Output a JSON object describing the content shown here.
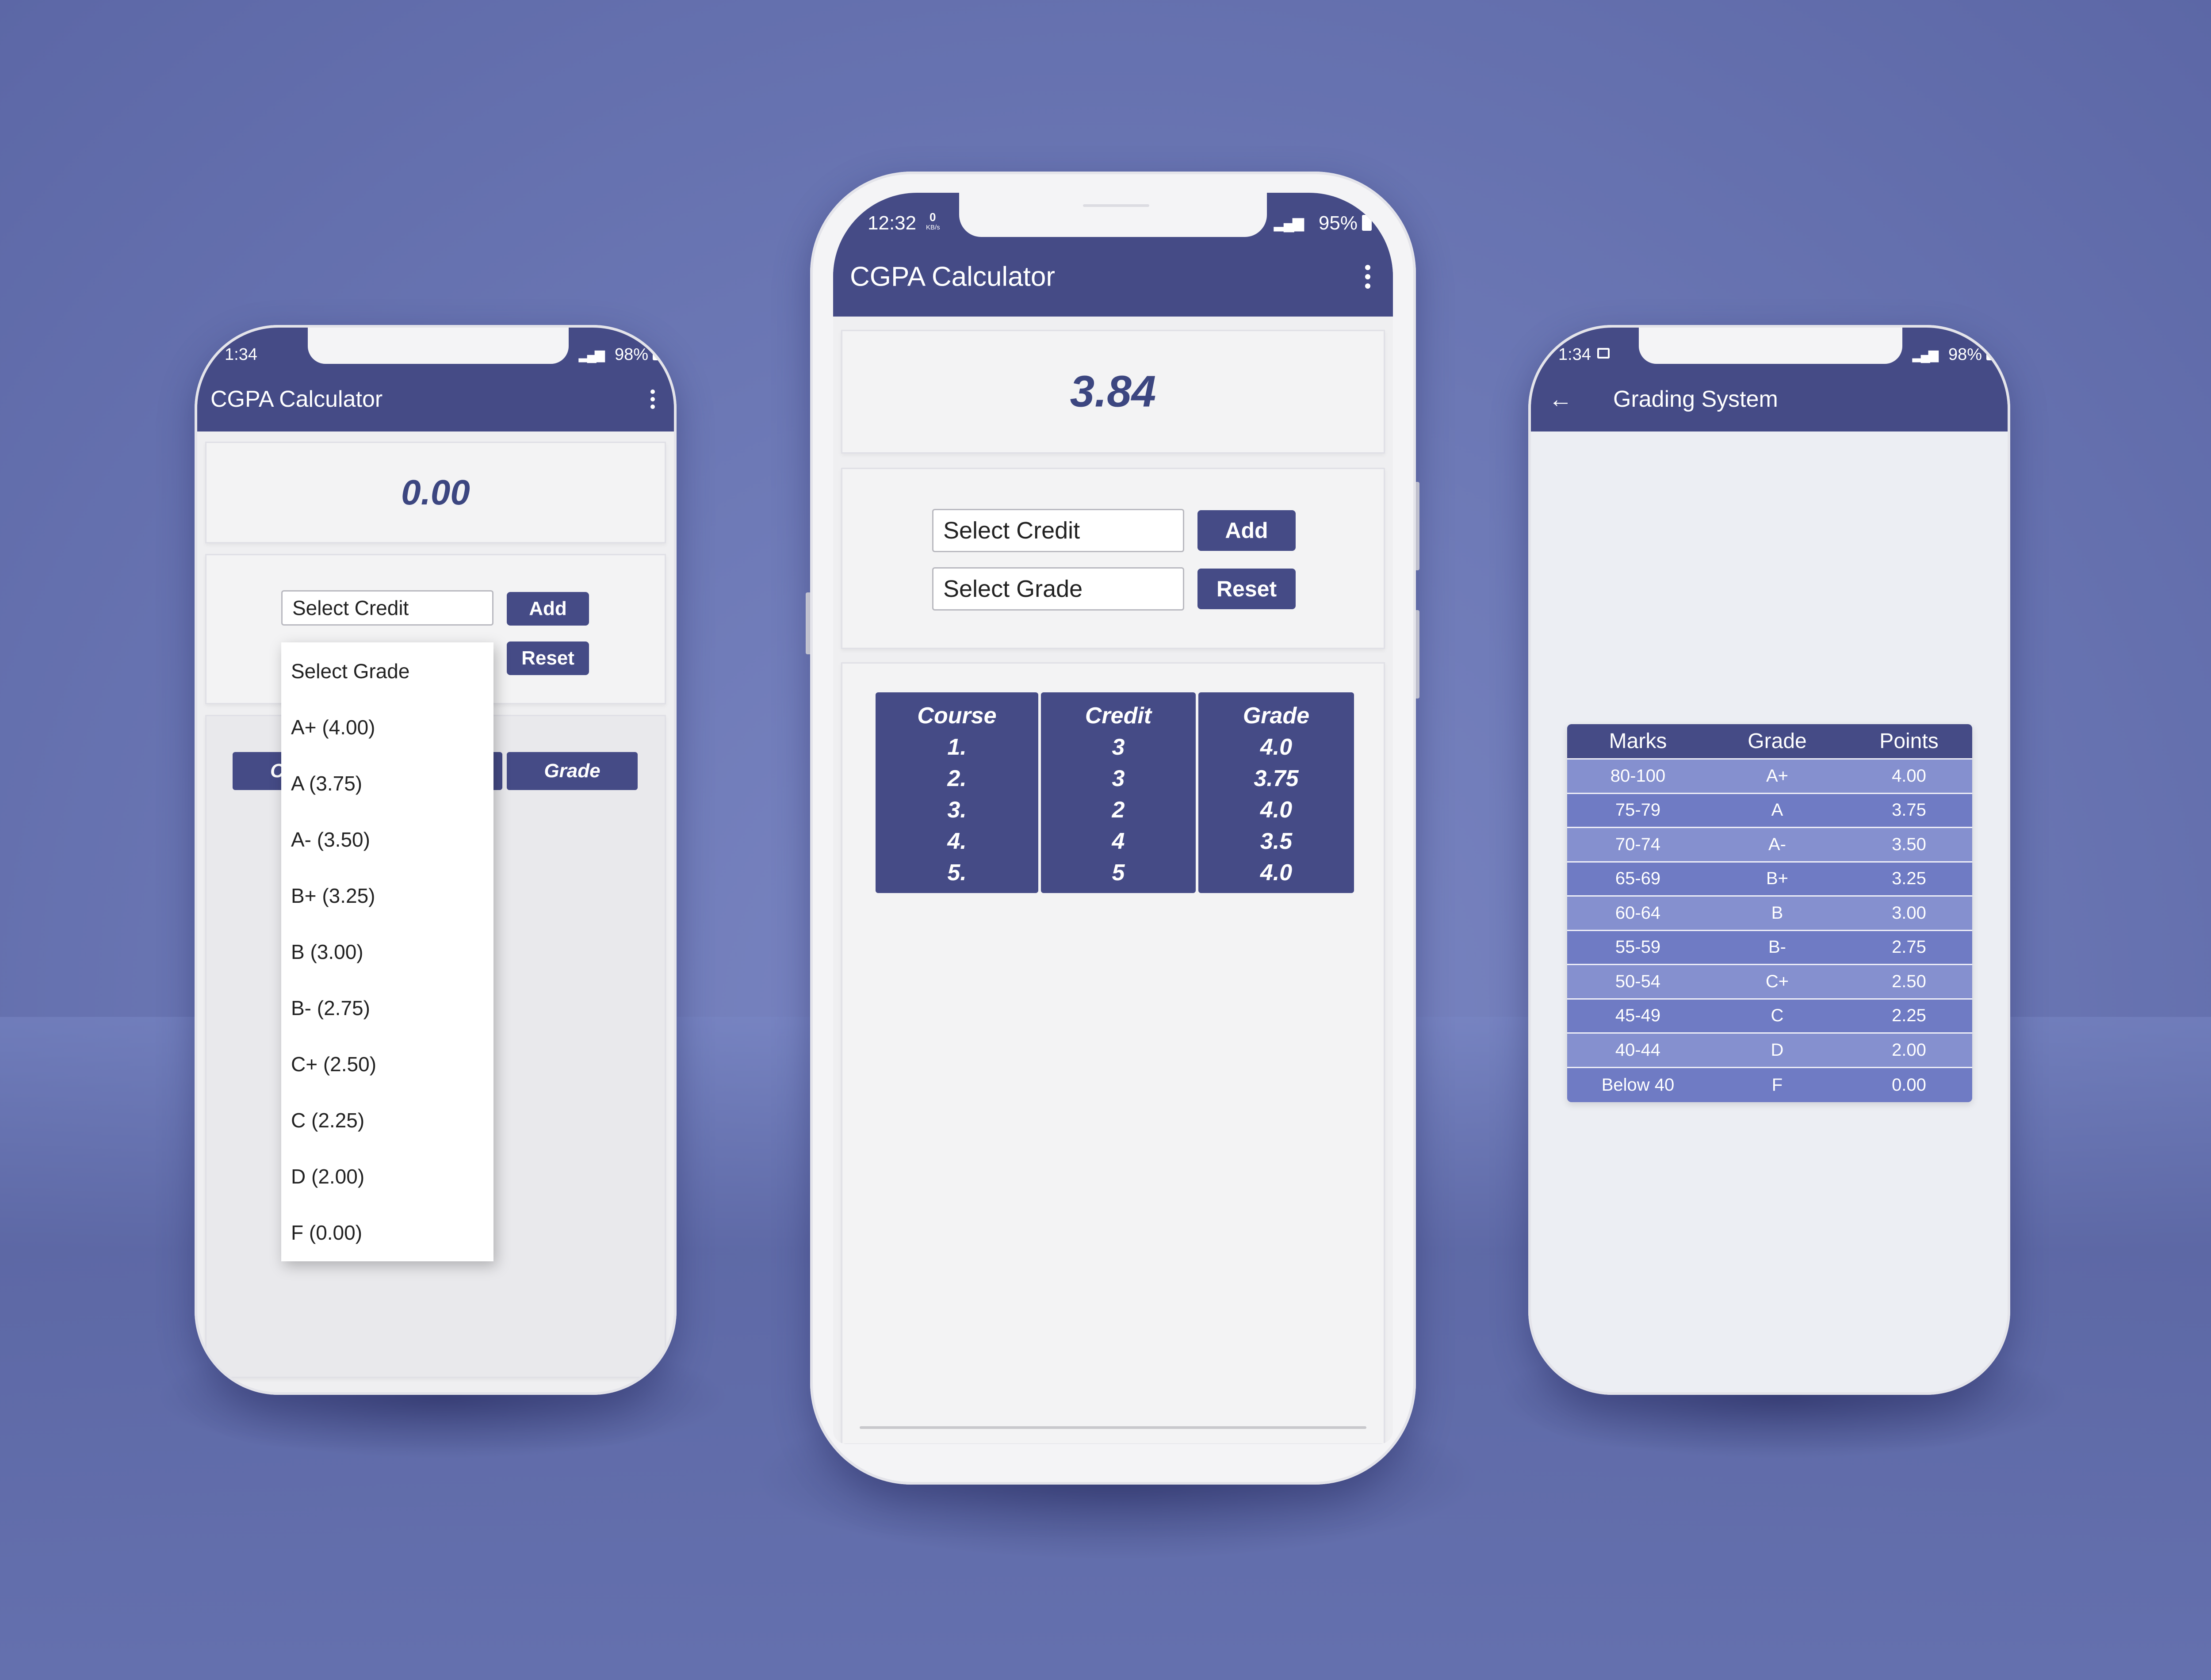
{
  "colors": {
    "background": "#6d79b6",
    "primary": "#454b86",
    "table_row_light": "#8590cf",
    "table_row_dark": "#6f7bc4",
    "result_text": "#3c4680"
  },
  "left_phone": {
    "status": {
      "time": "1:34",
      "battery": "98%"
    },
    "app_title": "CGPA Calculator",
    "menu_icon": "more-vert-icon",
    "cgpa_value": "0.00",
    "credit_placeholder": "Select Credit",
    "add_label": "Add",
    "reset_label": "Reset",
    "table_headers": [
      "C",
      "Grade"
    ],
    "grade_dropdown": {
      "options": [
        "Select Grade",
        "A+ (4.00)",
        "A (3.75)",
        "A- (3.50)",
        "B+ (3.25)",
        "B (3.00)",
        "B- (2.75)",
        "C+ (2.50)",
        "C (2.25)",
        "D (2.00)",
        "F (0.00)"
      ]
    }
  },
  "center_phone": {
    "status": {
      "time": "12:32",
      "net_speed": "0",
      "net_unit": "KB/s",
      "battery": "95%"
    },
    "app_title": "CGPA Calculator",
    "menu_icon": "more-vert-icon",
    "cgpa_value": "3.84",
    "credit_placeholder": "Select Credit",
    "grade_placeholder": "Select Grade",
    "add_label": "Add",
    "reset_label": "Reset",
    "table": {
      "headers": [
        "Course",
        "Credit",
        "Grade"
      ],
      "rows": [
        [
          "1.",
          "3",
          "4.0"
        ],
        [
          "2.",
          "3",
          "3.75"
        ],
        [
          "3.",
          "2",
          "4.0"
        ],
        [
          "4.",
          "4",
          "3.5"
        ],
        [
          "5.",
          "5",
          "4.0"
        ]
      ]
    }
  },
  "right_phone": {
    "status": {
      "time": "1:34",
      "battery": "98%"
    },
    "back_icon": "arrow-back-icon",
    "title": "Grading System",
    "table": {
      "headers": [
        "Marks",
        "Grade",
        "Points"
      ],
      "rows": [
        [
          "80-100",
          "A+",
          "4.00"
        ],
        [
          "75-79",
          "A",
          "3.75"
        ],
        [
          "70-74",
          "A-",
          "3.50"
        ],
        [
          "65-69",
          "B+",
          "3.25"
        ],
        [
          "60-64",
          "B",
          "3.00"
        ],
        [
          "55-59",
          "B-",
          "2.75"
        ],
        [
          "50-54",
          "C+",
          "2.50"
        ],
        [
          "45-49",
          "C",
          "2.25"
        ],
        [
          "40-44",
          "D",
          "2.00"
        ],
        [
          "Below 40",
          "F",
          "0.00"
        ]
      ]
    }
  }
}
